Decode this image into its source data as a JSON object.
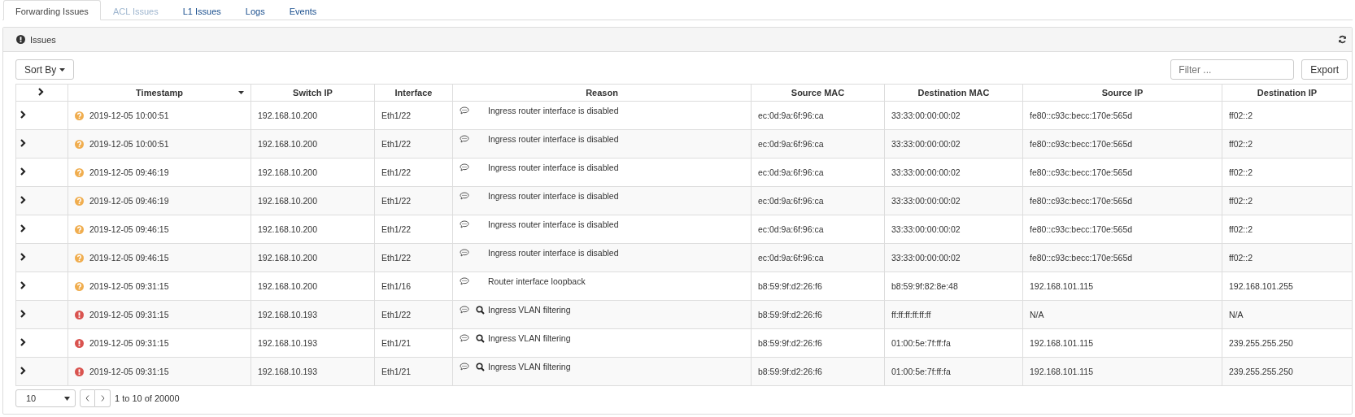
{
  "tabs": [
    {
      "label": "Forwarding Issues",
      "selected": true,
      "disabled": false
    },
    {
      "label": "ACL Issues",
      "selected": false,
      "disabled": true
    },
    {
      "label": "L1 Issues",
      "selected": false,
      "disabled": false
    },
    {
      "label": "Logs",
      "selected": false,
      "disabled": false
    },
    {
      "label": "Events",
      "selected": false,
      "disabled": false
    }
  ],
  "panel": {
    "title": "Issues"
  },
  "toolbar": {
    "sort_button": "Sort By",
    "filter": {
      "placeholder": "Filter ..."
    },
    "export_button": "Export"
  },
  "table": {
    "columns": [
      "Timestamp",
      "Switch IP",
      "Interface",
      "Reason",
      "Source MAC",
      "Destination MAC",
      "Source IP",
      "Destination IP"
    ],
    "rows": [
      {
        "kind": "warning",
        "timestamp": "2019-12-05 10:00:51",
        "switch_ip": "192.168.10.200",
        "interface": "Eth1/22",
        "reason": "Ingress router interface is disabled",
        "search_icon": false,
        "source_mac": "ec:0d:9a:6f:96:ca",
        "destination_mac": "33:33:00:00:00:02",
        "source_ip": "fe80::c93c:becc:170e:565d",
        "destination_ip": "ff02::2"
      },
      {
        "kind": "warning",
        "timestamp": "2019-12-05 10:00:51",
        "switch_ip": "192.168.10.200",
        "interface": "Eth1/22",
        "reason": "Ingress router interface is disabled",
        "search_icon": false,
        "source_mac": "ec:0d:9a:6f:96:ca",
        "destination_mac": "33:33:00:00:00:02",
        "source_ip": "fe80::c93c:becc:170e:565d",
        "destination_ip": "ff02::2"
      },
      {
        "kind": "warning",
        "timestamp": "2019-12-05 09:46:19",
        "switch_ip": "192.168.10.200",
        "interface": "Eth1/22",
        "reason": "Ingress router interface is disabled",
        "search_icon": false,
        "source_mac": "ec:0d:9a:6f:96:ca",
        "destination_mac": "33:33:00:00:00:02",
        "source_ip": "fe80::c93c:becc:170e:565d",
        "destination_ip": "ff02::2"
      },
      {
        "kind": "warning",
        "timestamp": "2019-12-05 09:46:19",
        "switch_ip": "192.168.10.200",
        "interface": "Eth1/22",
        "reason": "Ingress router interface is disabled",
        "search_icon": false,
        "source_mac": "ec:0d:9a:6f:96:ca",
        "destination_mac": "33:33:00:00:00:02",
        "source_ip": "fe80::c93c:becc:170e:565d",
        "destination_ip": "ff02::2"
      },
      {
        "kind": "warning",
        "timestamp": "2019-12-05 09:46:15",
        "switch_ip": "192.168.10.200",
        "interface": "Eth1/22",
        "reason": "Ingress router interface is disabled",
        "search_icon": false,
        "source_mac": "ec:0d:9a:6f:96:ca",
        "destination_mac": "33:33:00:00:00:02",
        "source_ip": "fe80::c93c:becc:170e:565d",
        "destination_ip": "ff02::2"
      },
      {
        "kind": "warning",
        "timestamp": "2019-12-05 09:46:15",
        "switch_ip": "192.168.10.200",
        "interface": "Eth1/22",
        "reason": "Ingress router interface is disabled",
        "search_icon": false,
        "source_mac": "ec:0d:9a:6f:96:ca",
        "destination_mac": "33:33:00:00:00:02",
        "source_ip": "fe80::c93c:becc:170e:565d",
        "destination_ip": "ff02::2"
      },
      {
        "kind": "warning",
        "timestamp": "2019-12-05 09:31:15",
        "switch_ip": "192.168.10.200",
        "interface": "Eth1/16",
        "reason": "Router interface loopback",
        "search_icon": false,
        "source_mac": "b8:59:9f:d2:26:f6",
        "destination_mac": "b8:59:9f:82:8e:48",
        "source_ip": "192.168.101.115",
        "destination_ip": "192.168.101.255"
      },
      {
        "kind": "error",
        "timestamp": "2019-12-05 09:31:15",
        "switch_ip": "192.168.10.193",
        "interface": "Eth1/22",
        "reason": "Ingress VLAN filtering",
        "search_icon": true,
        "source_mac": "b8:59:9f:d2:26:f6",
        "destination_mac": "ff:ff:ff:ff:ff:ff",
        "source_ip": "N/A",
        "destination_ip": "N/A"
      },
      {
        "kind": "error",
        "timestamp": "2019-12-05 09:31:15",
        "switch_ip": "192.168.10.193",
        "interface": "Eth1/21",
        "reason": "Ingress VLAN filtering",
        "search_icon": true,
        "source_mac": "b8:59:9f:d2:26:f6",
        "destination_mac": "01:00:5e:7f:ff:fa",
        "source_ip": "192.168.101.115",
        "destination_ip": "239.255.255.250"
      },
      {
        "kind": "error",
        "timestamp": "2019-12-05 09:31:15",
        "switch_ip": "192.168.10.193",
        "interface": "Eth1/21",
        "reason": "Ingress VLAN filtering",
        "search_icon": true,
        "source_mac": "b8:59:9f:d2:26:f6",
        "destination_mac": "01:00:5e:7f:ff:fa",
        "source_ip": "192.168.101.115",
        "destination_ip": "239.255.255.250"
      }
    ]
  },
  "pagination": {
    "page_size": "10",
    "range": "1 to 10 of 20000"
  }
}
